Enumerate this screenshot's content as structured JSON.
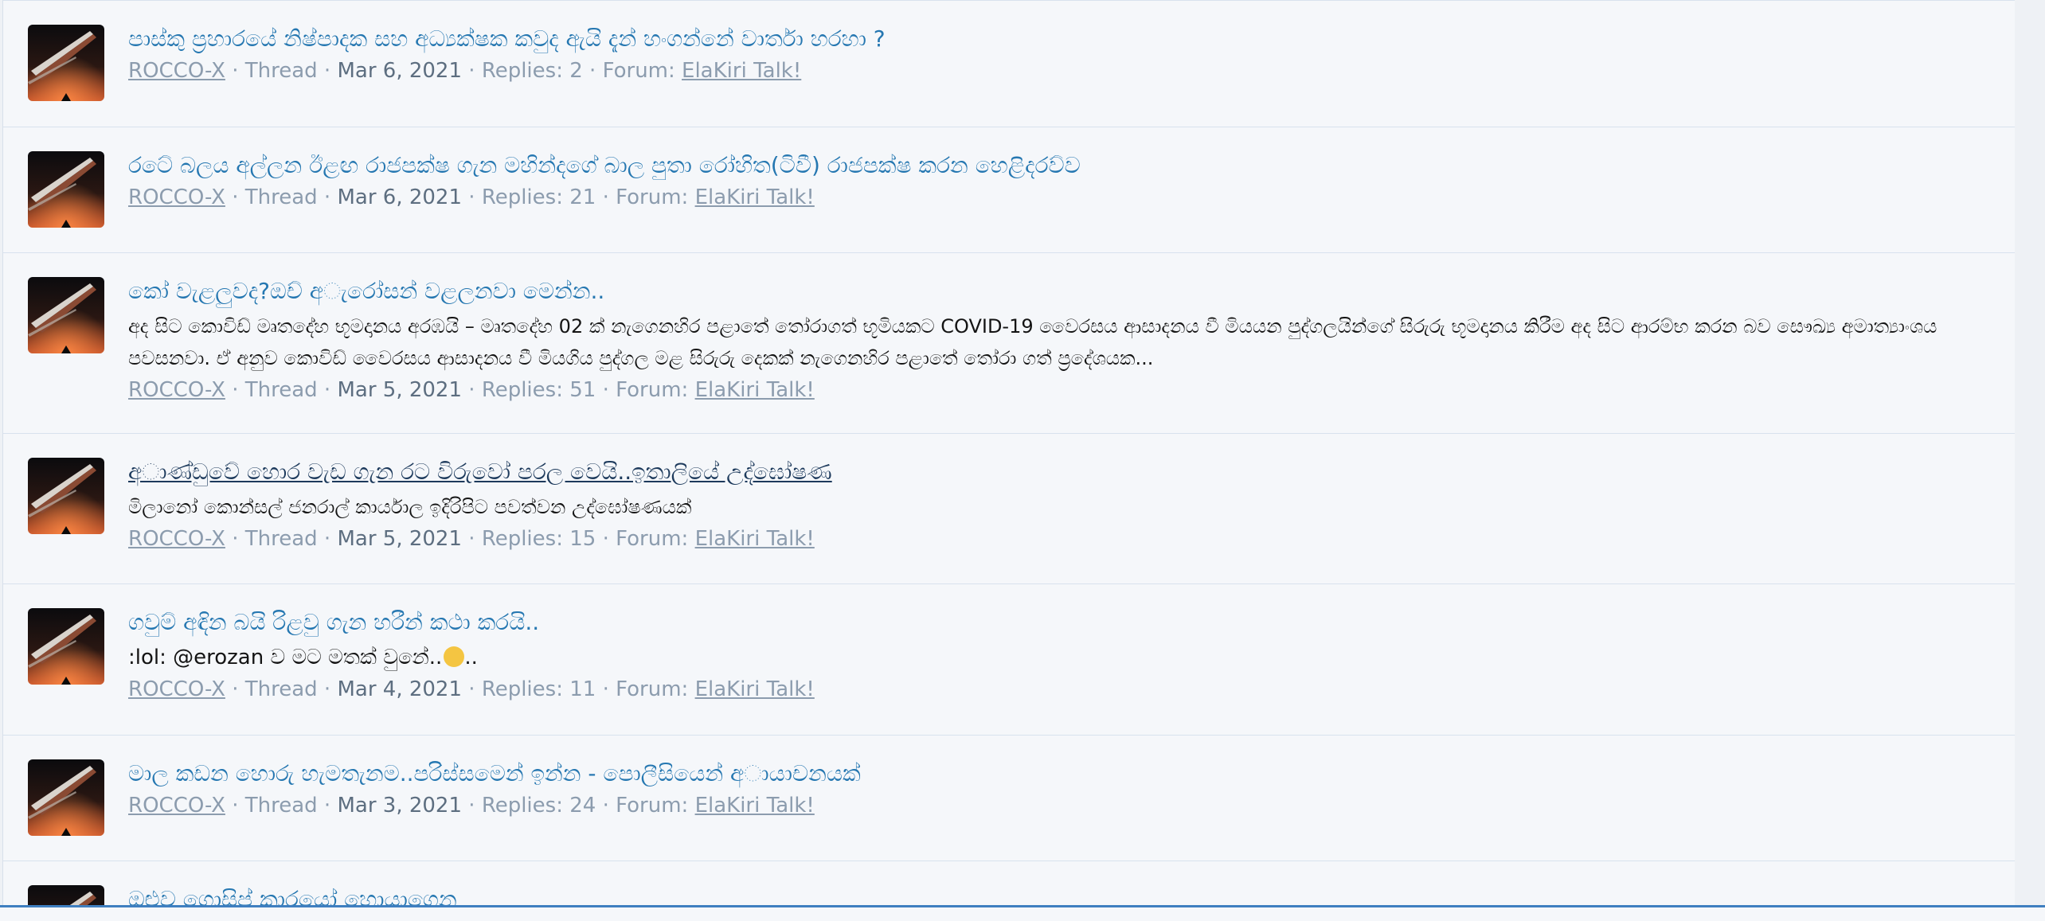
{
  "threads": [
    {
      "title": "පාස්කු ප්‍රහාරයේ නිෂ්පාදක සහ අධ්‍යක්ෂක කවුද ඇයි දැන් හංගන්නේ වාර්තා හරහා ?",
      "snippet": "",
      "author": "ROCCO-X",
      "type": "Thread",
      "date": "Mar 6, 2021",
      "replies": "Replies: 2",
      "forum_label": "Forum:",
      "forum": "ElaKiri Talk!"
    },
    {
      "title": "රටේ බලය අල්ලන ඊළඟ රාජපක්ෂ ගැන මහින්දගේ බාල පුතා රෝහිත(ටිවී) රාජපක්ෂ කරන හෙළිදරව්ව",
      "snippet": "",
      "author": "ROCCO-X",
      "type": "Thread",
      "date": "Mar 6, 2021",
      "replies": "Replies: 21",
      "forum_label": "Forum:",
      "forum": "ElaKiri Talk!"
    },
    {
      "title": "කෝ වැළලුවද?ඔච් අ◌ැරෝසන් වළලනවා මෙන්න..",
      "snippet": "අද සිට කොවිඩ් මෘතදේහ භූමදානය අරඹයි – මෘතදේහ 02 ක් නැගෙනහිර පළාතේ තෝරාගත් භූමියකට COVID-19 වෛරසය ආසාදනය වී මියයන පුද්ගලයින්ගේ සිරුරු භූමදානය කිරීම අද සිට ආරම්භ කරන බව සෞඛ්‍ය අමාත්‍යාංශය පවසනවා. ඒ අනුව කොවිඩ් වෛරසය ආසාදනය වී මියගිය පුද්ගල මළ සිරුරු දෙකක් නැගෙනහිර පළාතේ තෝරා ගත් ප්‍රදේශයක...",
      "author": "ROCCO-X",
      "type": "Thread",
      "date": "Mar 5, 2021",
      "replies": "Replies: 51",
      "forum_label": "Forum:",
      "forum": "ElaKiri Talk!"
    },
    {
      "title": "අ◌ාණ්ඩුවේ හොර වැඩ ගැන රට විරුවෝ පරල වෙයි..ඉතාලියේ උද්ඝෝෂණ",
      "snippet": "මිලානෝ කොන්සල් ජනරාල් කාර්යාල ඉදිරිපිට පවත්වන උද්ඝෝෂණයක්",
      "author": "ROCCO-X",
      "type": "Thread",
      "date": "Mar 5, 2021",
      "replies": "Replies: 15",
      "forum_label": "Forum:",
      "forum": "ElaKiri Talk!"
    },
    {
      "title": "ගවුම් අඳින බයි රිළවු ගැන හරීන් කථා කරයි..",
      "snippet": ":lol: @erozan ව මට මතක් වුනේ..",
      "author": "ROCCO-X",
      "type": "Thread",
      "date": "Mar 4, 2021",
      "replies": "Replies: 11",
      "forum_label": "Forum:",
      "forum": "ElaKiri Talk!"
    },
    {
      "title": "මාල කඩන හොරු හැමතැනම..පරිස්සමෙන් ඉන්න - පොලීසියෙන් අ◌ායාචනයක්",
      "snippet": "",
      "author": "ROCCO-X",
      "type": "Thread",
      "date": "Mar 3, 2021",
      "replies": "Replies: 24",
      "forum_label": "Forum:",
      "forum": "ElaKiri Talk!"
    },
    {
      "title": "ඔළුව ගොසිප් කාරයෝ හොයාගෙන"
    }
  ],
  "separator": "·",
  "colors": {
    "title": "#2577b1",
    "meta": "#8c9cae",
    "background": "#f5f7fa"
  }
}
